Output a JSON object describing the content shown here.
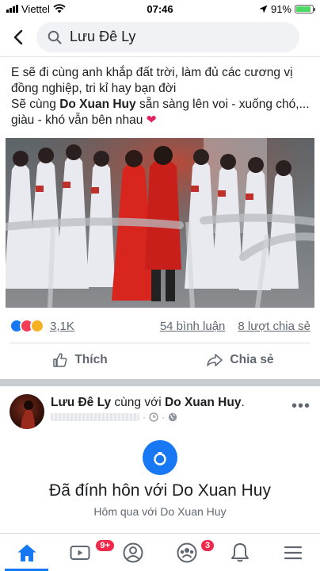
{
  "status_bar": {
    "carrier": "Viettel",
    "time": "07:46",
    "battery": "91%",
    "battery_level": 0.91
  },
  "search": {
    "query": "Lưu Đê Ly"
  },
  "post": {
    "line1": "E sẽ đi cùng anh khắp đất trời, làm đủ các cương vị đồng nghiệp, tri kỉ hay bạn đời",
    "line2_prefix": "Sẽ cùng ",
    "line2_name": "Do Xuan Huy",
    "line2_suffix": " sẵn sàng lên voi - xuống chó,... giàu - khó vẫn bên nhau ",
    "heart": "❤️",
    "reactions_count": "3,1K",
    "comments": "54 bình luận",
    "shares": "8 lượt chia sẻ",
    "like_label": "Thích",
    "share_label": "Chia sẻ"
  },
  "post2": {
    "author": "Lưu Đê Ly",
    "with_text": " cùng với ",
    "tagged": "Do Xuan Huy",
    "period": ".",
    "more": "•••",
    "engaged_title": "Đã đính hôn với Do Xuan Huy",
    "engaged_sub": "Hôm qua với Do Xuan Huy"
  },
  "nav": {
    "video_badge": "9+",
    "groups_badge": "3"
  },
  "colors": {
    "accent": "#1877f2",
    "badge": "#f02849"
  }
}
